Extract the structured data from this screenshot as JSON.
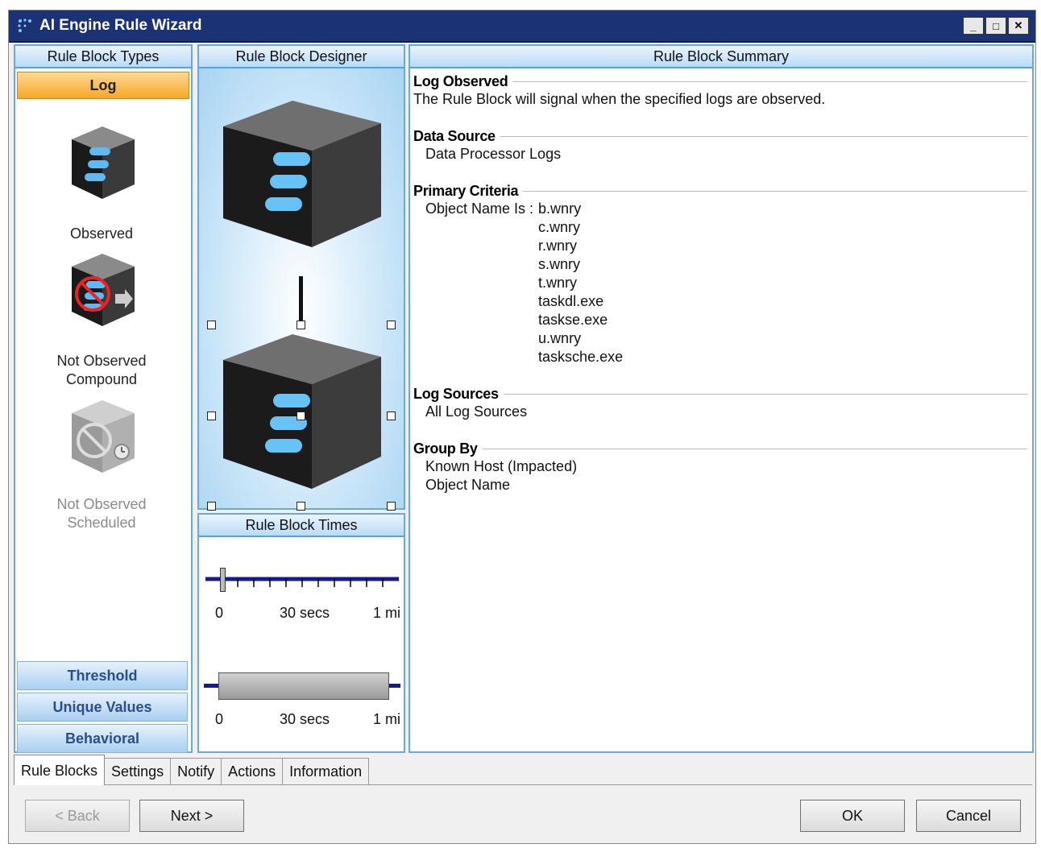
{
  "window": {
    "title": "AI Engine Rule Wizard"
  },
  "panels": {
    "types_header": "Rule Block Types",
    "designer_header": "Rule Block Designer",
    "summary_header": "Rule Block Summary",
    "times_header": "Rule Block Times"
  },
  "rule_block_types": {
    "selected_category": "Log",
    "items": [
      {
        "label": "Observed",
        "icon": "log-observed-cube-icon",
        "enabled": true
      },
      {
        "label": "Not Observed\nCompound",
        "icon": "log-not-observed-compound-cube-icon",
        "enabled": true
      },
      {
        "label": "Not Observed\nScheduled",
        "icon": "log-not-observed-scheduled-cube-icon",
        "enabled": false
      }
    ],
    "other_categories": [
      "Threshold",
      "Unique Values",
      "Behavioral"
    ]
  },
  "summary": {
    "log_observed": {
      "heading": "Log Observed",
      "text": "The Rule Block will signal when the specified logs are observed."
    },
    "data_source": {
      "heading": "Data Source",
      "text": "Data Processor Logs"
    },
    "primary_criteria": {
      "heading": "Primary Criteria",
      "label": "Object Name Is :",
      "values": [
        "b.wnry",
        "c.wnry",
        "r.wnry",
        "s.wnry",
        "t.wnry",
        "taskdl.exe",
        "taskse.exe",
        "u.wnry",
        "tasksche.exe"
      ]
    },
    "log_sources": {
      "heading": "Log Sources",
      "text": "All Log Sources"
    },
    "group_by": {
      "heading": "Group By",
      "values": [
        "Known Host (Impacted)",
        "Object Name"
      ]
    }
  },
  "times": {
    "slider1": {
      "labels": [
        "0",
        "30 secs",
        "1 mi"
      ],
      "thumb_value": 0
    },
    "slider2": {
      "labels": [
        "0",
        "30 secs",
        "1 mi"
      ],
      "range_start": 0,
      "range_end": 1
    }
  },
  "tabs": [
    "Rule Blocks",
    "Settings",
    "Notify",
    "Actions",
    "Information"
  ],
  "active_tab": "Rule Blocks",
  "buttons": {
    "back": "< Back",
    "next": "Next >",
    "ok": "OK",
    "cancel": "Cancel"
  },
  "win_buttons": {
    "minimize": "_",
    "maximize": "□",
    "close": "✕"
  }
}
